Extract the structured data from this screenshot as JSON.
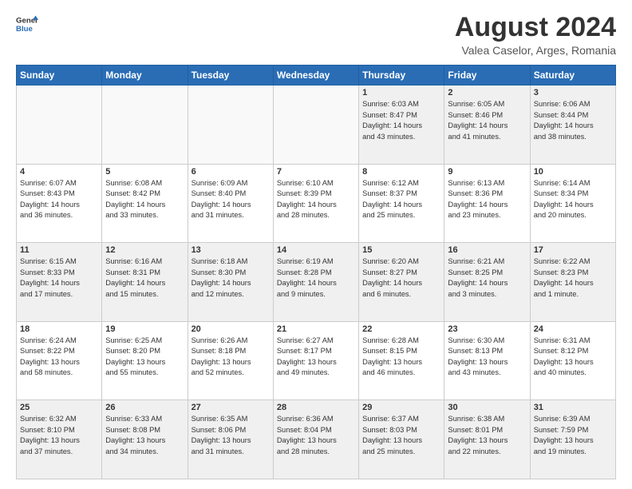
{
  "header": {
    "logo_general": "General",
    "logo_blue": "Blue",
    "title": "August 2024",
    "subtitle": "Valea Caselor, Arges, Romania"
  },
  "weekdays": [
    "Sunday",
    "Monday",
    "Tuesday",
    "Wednesday",
    "Thursday",
    "Friday",
    "Saturday"
  ],
  "weeks": [
    [
      {
        "day": "",
        "info": "",
        "empty": true
      },
      {
        "day": "",
        "info": "",
        "empty": true
      },
      {
        "day": "",
        "info": "",
        "empty": true
      },
      {
        "day": "",
        "info": "",
        "empty": true
      },
      {
        "day": "1",
        "info": "Sunrise: 6:03 AM\nSunset: 8:47 PM\nDaylight: 14 hours\nand 43 minutes."
      },
      {
        "day": "2",
        "info": "Sunrise: 6:05 AM\nSunset: 8:46 PM\nDaylight: 14 hours\nand 41 minutes."
      },
      {
        "day": "3",
        "info": "Sunrise: 6:06 AM\nSunset: 8:44 PM\nDaylight: 14 hours\nand 38 minutes."
      }
    ],
    [
      {
        "day": "4",
        "info": "Sunrise: 6:07 AM\nSunset: 8:43 PM\nDaylight: 14 hours\nand 36 minutes."
      },
      {
        "day": "5",
        "info": "Sunrise: 6:08 AM\nSunset: 8:42 PM\nDaylight: 14 hours\nand 33 minutes."
      },
      {
        "day": "6",
        "info": "Sunrise: 6:09 AM\nSunset: 8:40 PM\nDaylight: 14 hours\nand 31 minutes."
      },
      {
        "day": "7",
        "info": "Sunrise: 6:10 AM\nSunset: 8:39 PM\nDaylight: 14 hours\nand 28 minutes."
      },
      {
        "day": "8",
        "info": "Sunrise: 6:12 AM\nSunset: 8:37 PM\nDaylight: 14 hours\nand 25 minutes."
      },
      {
        "day": "9",
        "info": "Sunrise: 6:13 AM\nSunset: 8:36 PM\nDaylight: 14 hours\nand 23 minutes."
      },
      {
        "day": "10",
        "info": "Sunrise: 6:14 AM\nSunset: 8:34 PM\nDaylight: 14 hours\nand 20 minutes."
      }
    ],
    [
      {
        "day": "11",
        "info": "Sunrise: 6:15 AM\nSunset: 8:33 PM\nDaylight: 14 hours\nand 17 minutes."
      },
      {
        "day": "12",
        "info": "Sunrise: 6:16 AM\nSunset: 8:31 PM\nDaylight: 14 hours\nand 15 minutes."
      },
      {
        "day": "13",
        "info": "Sunrise: 6:18 AM\nSunset: 8:30 PM\nDaylight: 14 hours\nand 12 minutes."
      },
      {
        "day": "14",
        "info": "Sunrise: 6:19 AM\nSunset: 8:28 PM\nDaylight: 14 hours\nand 9 minutes."
      },
      {
        "day": "15",
        "info": "Sunrise: 6:20 AM\nSunset: 8:27 PM\nDaylight: 14 hours\nand 6 minutes."
      },
      {
        "day": "16",
        "info": "Sunrise: 6:21 AM\nSunset: 8:25 PM\nDaylight: 14 hours\nand 3 minutes."
      },
      {
        "day": "17",
        "info": "Sunrise: 6:22 AM\nSunset: 8:23 PM\nDaylight: 14 hours\nand 1 minute."
      }
    ],
    [
      {
        "day": "18",
        "info": "Sunrise: 6:24 AM\nSunset: 8:22 PM\nDaylight: 13 hours\nand 58 minutes."
      },
      {
        "day": "19",
        "info": "Sunrise: 6:25 AM\nSunset: 8:20 PM\nDaylight: 13 hours\nand 55 minutes."
      },
      {
        "day": "20",
        "info": "Sunrise: 6:26 AM\nSunset: 8:18 PM\nDaylight: 13 hours\nand 52 minutes."
      },
      {
        "day": "21",
        "info": "Sunrise: 6:27 AM\nSunset: 8:17 PM\nDaylight: 13 hours\nand 49 minutes."
      },
      {
        "day": "22",
        "info": "Sunrise: 6:28 AM\nSunset: 8:15 PM\nDaylight: 13 hours\nand 46 minutes."
      },
      {
        "day": "23",
        "info": "Sunrise: 6:30 AM\nSunset: 8:13 PM\nDaylight: 13 hours\nand 43 minutes."
      },
      {
        "day": "24",
        "info": "Sunrise: 6:31 AM\nSunset: 8:12 PM\nDaylight: 13 hours\nand 40 minutes."
      }
    ],
    [
      {
        "day": "25",
        "info": "Sunrise: 6:32 AM\nSunset: 8:10 PM\nDaylight: 13 hours\nand 37 minutes."
      },
      {
        "day": "26",
        "info": "Sunrise: 6:33 AM\nSunset: 8:08 PM\nDaylight: 13 hours\nand 34 minutes."
      },
      {
        "day": "27",
        "info": "Sunrise: 6:35 AM\nSunset: 8:06 PM\nDaylight: 13 hours\nand 31 minutes."
      },
      {
        "day": "28",
        "info": "Sunrise: 6:36 AM\nSunset: 8:04 PM\nDaylight: 13 hours\nand 28 minutes."
      },
      {
        "day": "29",
        "info": "Sunrise: 6:37 AM\nSunset: 8:03 PM\nDaylight: 13 hours\nand 25 minutes."
      },
      {
        "day": "30",
        "info": "Sunrise: 6:38 AM\nSunset: 8:01 PM\nDaylight: 13 hours\nand 22 minutes."
      },
      {
        "day": "31",
        "info": "Sunrise: 6:39 AM\nSunset: 7:59 PM\nDaylight: 13 hours\nand 19 minutes."
      }
    ]
  ]
}
